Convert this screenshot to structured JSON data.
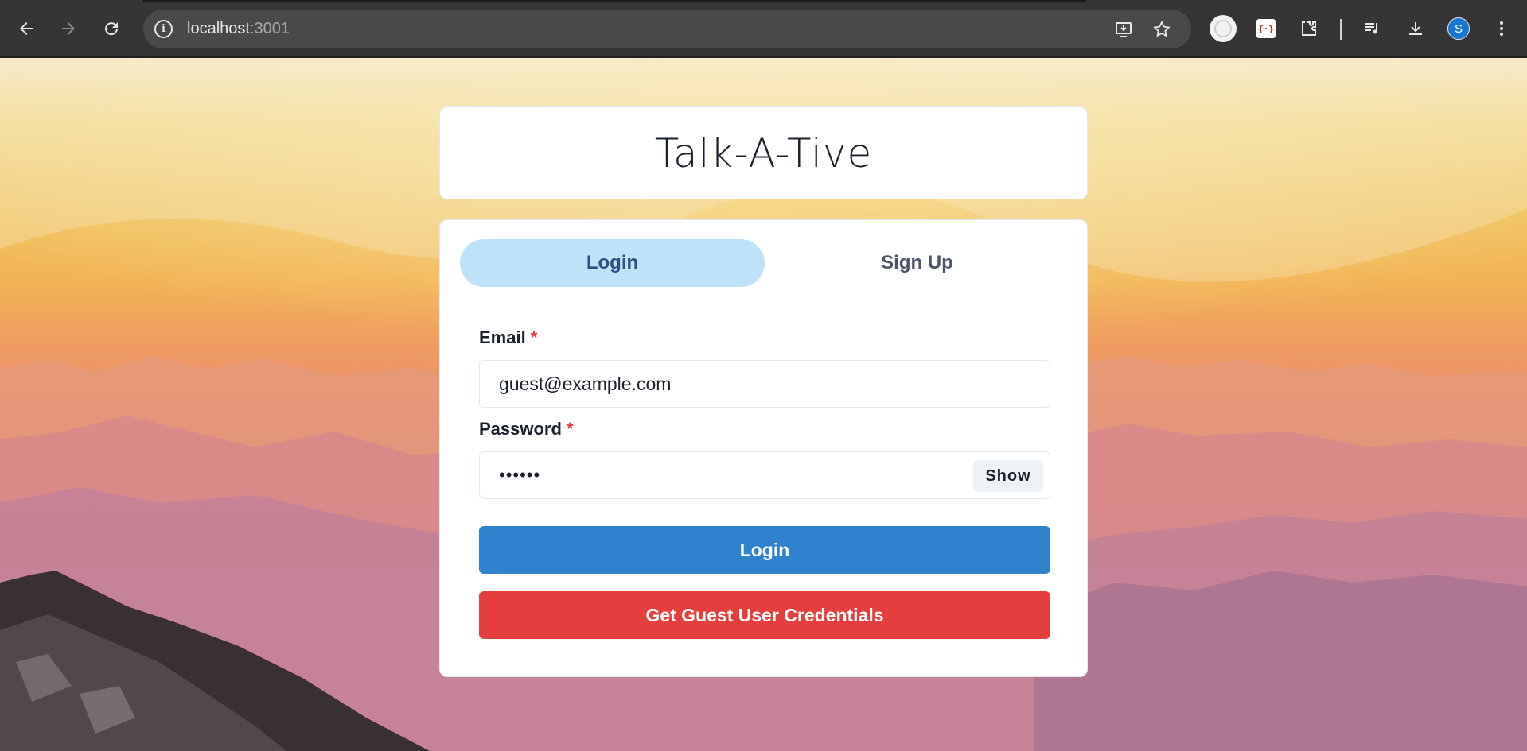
{
  "browser": {
    "url_host": "localhost",
    "url_port": ":3001",
    "icons": {
      "back": "back-arrow-icon",
      "forward": "forward-arrow-icon",
      "reload": "reload-icon",
      "info": "site-info-icon",
      "install": "install-app-icon",
      "bookmark": "bookmark-star-icon",
      "extensions": "puzzle-extensions-icon",
      "media": "media-controls-icon",
      "downloads": "download-icon",
      "menu": "kebab-menu-icon"
    },
    "profile_initial": "S",
    "ext_badge": "{·}"
  },
  "app": {
    "title": "Talk-A-Tive"
  },
  "tabs": [
    {
      "label": "Login",
      "active": true
    },
    {
      "label": "Sign Up",
      "active": false
    }
  ],
  "form": {
    "email_label": "Email",
    "email_required": "*",
    "email_value": "guest@example.com",
    "password_label": "Password",
    "password_required": "*",
    "password_value": "••••••",
    "show_label": "Show",
    "login_button": "Login",
    "guest_button": "Get Guest User Credentials"
  },
  "colors": {
    "active_tab_bg": "#bee3f8",
    "login_button": "#3182ce",
    "guest_button": "#e53e3e",
    "required_asterisk": "#e53e3e"
  }
}
